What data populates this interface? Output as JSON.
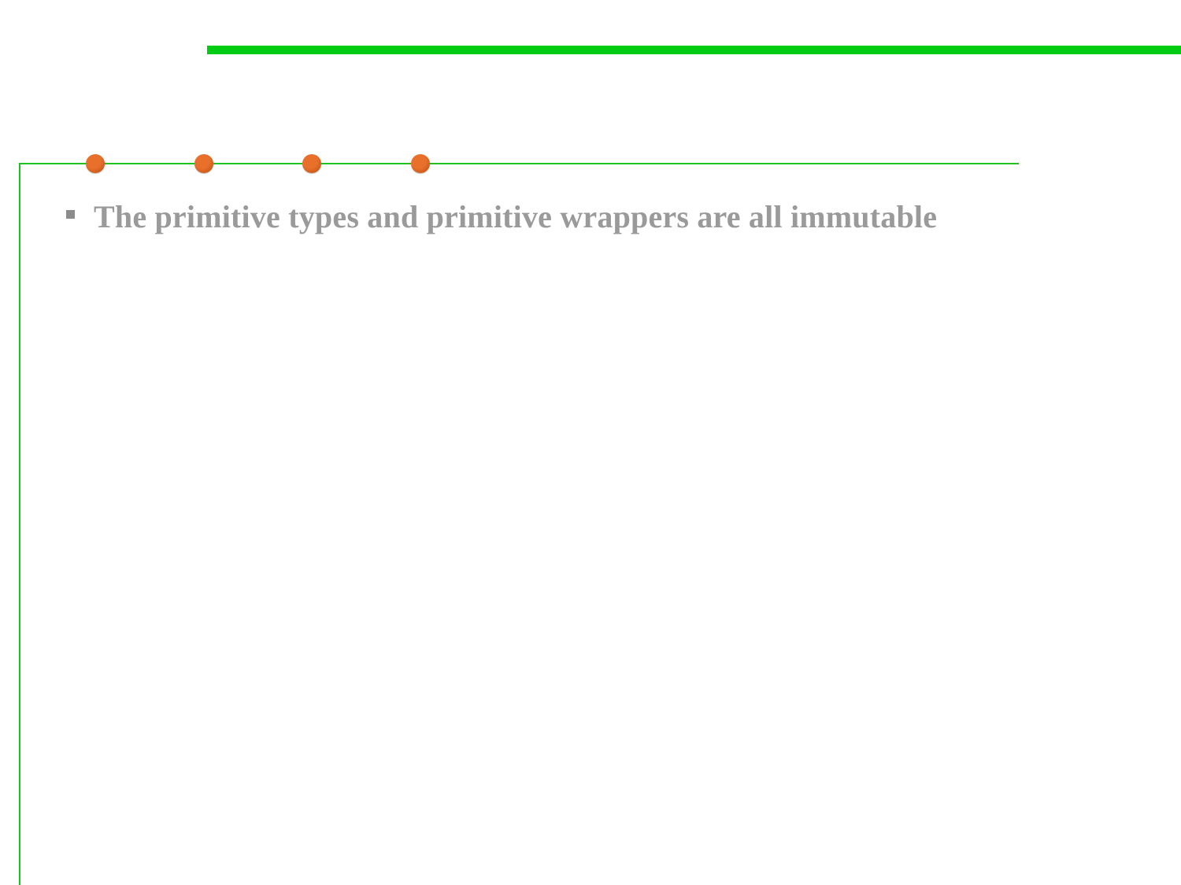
{
  "colors": {
    "accent_green": "#00cc14",
    "rule_green": "#20c020",
    "dot_orange": "#e8702a",
    "dot_orange_dark": "#b84a10",
    "text_gray": "#9a9a9a",
    "bullet_gray": "#8c8c8c"
  },
  "decorations": {
    "dot_count": 4,
    "bullet_icon": "square-bullet-icon"
  },
  "content": {
    "bullets": [
      "The primitive types and primitive wrappers are all immutable"
    ]
  }
}
